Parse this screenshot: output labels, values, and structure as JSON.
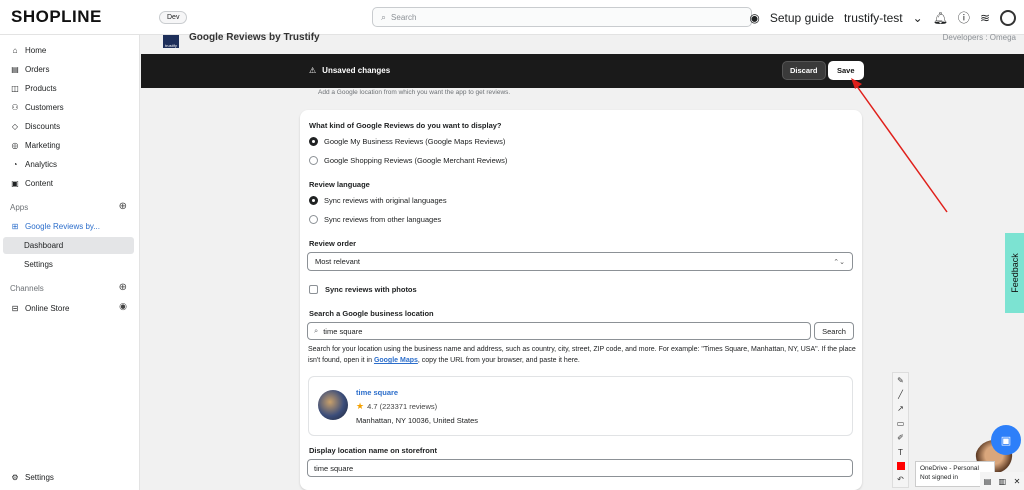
{
  "topbar": {
    "logo": "SHOPLINE",
    "env_badge": "Dev",
    "search_placeholder": "Search",
    "setup_guide": "Setup guide",
    "store_name": "trustify-test"
  },
  "sidebar": {
    "items": [
      {
        "label": "Home",
        "icon": "home-icon"
      },
      {
        "label": "Orders",
        "icon": "orders-icon"
      },
      {
        "label": "Products",
        "icon": "products-icon"
      },
      {
        "label": "Customers",
        "icon": "customers-icon"
      },
      {
        "label": "Discounts",
        "icon": "discounts-icon"
      },
      {
        "label": "Marketing",
        "icon": "marketing-icon"
      },
      {
        "label": "Analytics",
        "icon": "analytics-icon"
      },
      {
        "label": "Content",
        "icon": "content-icon"
      }
    ],
    "apps_label": "Apps",
    "app_name": "Google Reviews by...",
    "app_sub": [
      "Dashboard",
      "Settings"
    ],
    "channels_label": "Channels",
    "online_store": "Online Store",
    "settings": "Settings"
  },
  "app_header": {
    "logo_text": "trustify",
    "title": "Google Reviews by Trustify",
    "developer": "Developers : Omega"
  },
  "unsaved_bar": {
    "message": "Unsaved changes",
    "discard": "Discard",
    "save": "Save"
  },
  "hint": "Add a Google location from which you want the app to get reviews.",
  "form": {
    "review_kind_label": "What kind of Google Reviews do you want to display?",
    "review_kind_options": [
      {
        "label": "Google My Business Reviews (Google Maps Reviews)",
        "selected": true
      },
      {
        "label": "Google Shopping Reviews (Google Merchant Reviews)",
        "selected": false
      }
    ],
    "language_label": "Review language",
    "language_options": [
      {
        "label": "Sync reviews with original languages",
        "selected": true
      },
      {
        "label": "Sync reviews from other languages",
        "selected": false
      }
    ],
    "order_label": "Review order",
    "order_value": "Most relevant",
    "photos_label": "Sync reviews with photos",
    "location_label": "Search a Google business location",
    "location_value": "time square",
    "search_button": "Search",
    "help_text_1": "Search for your location using the business name and address, such as country, city, street, ZIP code, and more. For example: \"Times Square, Manhattan, NY, USA\". If the place isn't found, open it in ",
    "help_link": "Google Maps",
    "help_text_2": ", copy the URL from your browser, and paste it here.",
    "place": {
      "name": "time square",
      "rating": "4.7 (223371 reviews)",
      "address": "Manhattan, NY 10036, United States"
    },
    "display_name_label": "Display location name on storefront",
    "display_name_value": "time square"
  },
  "feedback": "Feedback",
  "onedrive": {
    "line1": "OneDrive - Personal",
    "line2": "Not signed in"
  },
  "colors": {
    "accent": "#2c6ecb",
    "unsaved_bg": "#1a1a1a",
    "feedback_bg": "#7ce3d2",
    "annotation_arrow": "#e0201b"
  }
}
